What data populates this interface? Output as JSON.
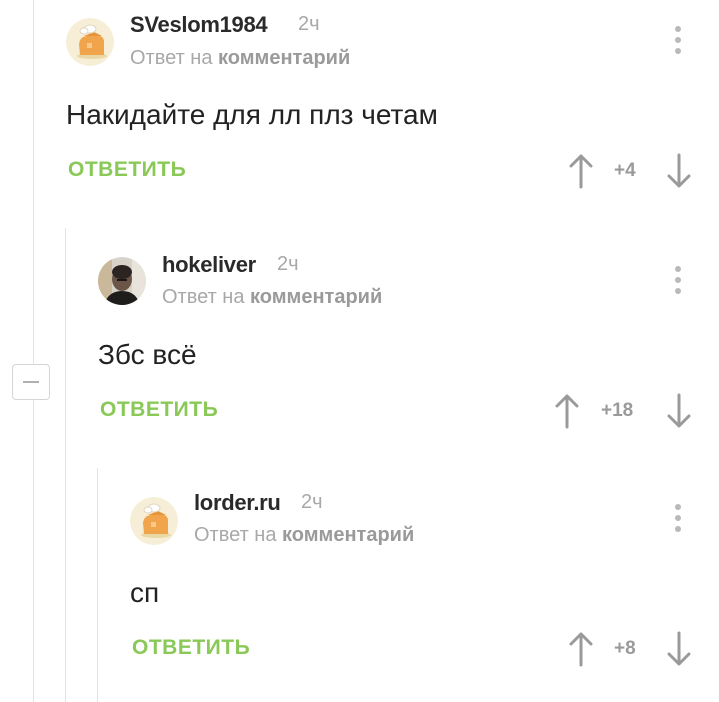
{
  "comments": [
    {
      "author": "SVeslom1984",
      "time": "2ч",
      "reply_prefix": "Ответ на",
      "reply_target": "комментарий",
      "text": "Накидайте для лл плз четам",
      "reply_label": "ОТВЕТИТЬ",
      "rating": "+4",
      "avatar": "default-avatar"
    },
    {
      "author": "hokeliver",
      "time": "2ч",
      "reply_prefix": "Ответ на",
      "reply_target": "комментарий",
      "text": "Збс всё",
      "reply_label": "ОТВЕТИТЬ",
      "rating": "+18",
      "avatar": "user-photo-avatar"
    },
    {
      "author": "lorder.ru",
      "time": "2ч",
      "reply_prefix": "Ответ на",
      "reply_target": "комментарий",
      "text": "сп",
      "reply_label": "ОТВЕТИТЬ",
      "rating": "+8",
      "avatar": "default-avatar"
    }
  ],
  "colors": {
    "reply_green": "#8ac858",
    "meta_gray": "#a8a8a8",
    "thread_line": "#e3e3e3"
  }
}
